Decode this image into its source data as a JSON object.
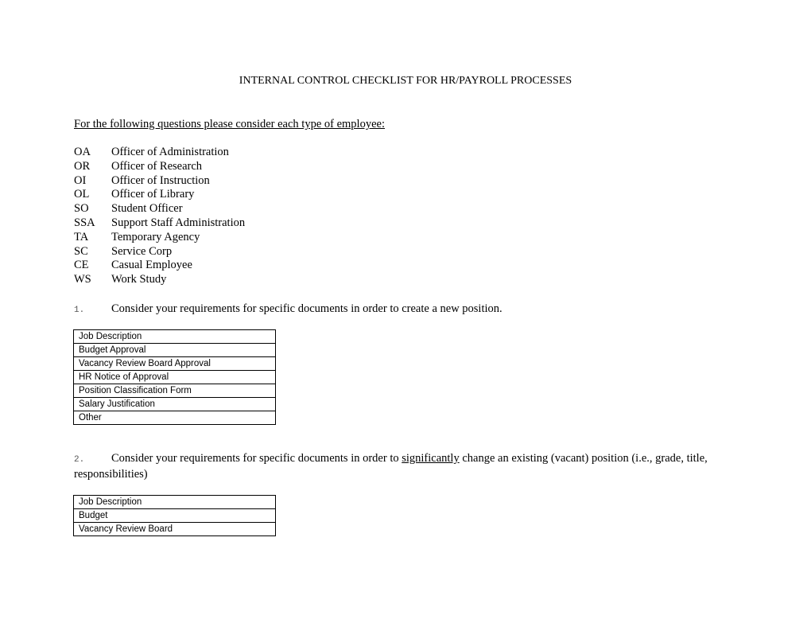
{
  "document": {
    "title": "INTERNAL CONTROL CHECKLIST FOR HR/PAYROLL PROCESSES",
    "intro": "For the following questions please consider each type of employee:",
    "employee_types": [
      {
        "code": "OA",
        "label": "Officer of Administration"
      },
      {
        "code": "OR",
        "label": "Officer of Research"
      },
      {
        "code": "OI",
        "label": "Officer of Instruction"
      },
      {
        "code": "OL",
        "label": "Officer of Library"
      },
      {
        "code": "SO",
        "label": "Student Officer"
      },
      {
        "code": "SSA",
        "label": "Support Staff Administration"
      },
      {
        "code": "TA",
        "label": "Temporary Agency"
      },
      {
        "code": "SC",
        "label": "Service Corp"
      },
      {
        "code": "CE",
        "label": "Casual Employee"
      },
      {
        "code": "WS",
        "label": "Work Study"
      }
    ],
    "questions": [
      {
        "number": "1.",
        "text": "Consider your requirements for specific documents in order to create a new position.",
        "documents": [
          "Job Description",
          "Budget Approval",
          "Vacancy Review Board Approval",
          "HR Notice of Approval",
          "Position Classification Form",
          "Salary Justification",
          "Other"
        ]
      },
      {
        "number": "2.",
        "text_before": "Consider your requirements for specific documents in order to ",
        "text_emphasis": "significantly",
        "text_after": " change an existing (vacant) position (i.e., grade, title, responsibilities)",
        "documents": [
          "Job Description",
          "Budget",
          "Vacancy Review Board"
        ]
      }
    ]
  }
}
